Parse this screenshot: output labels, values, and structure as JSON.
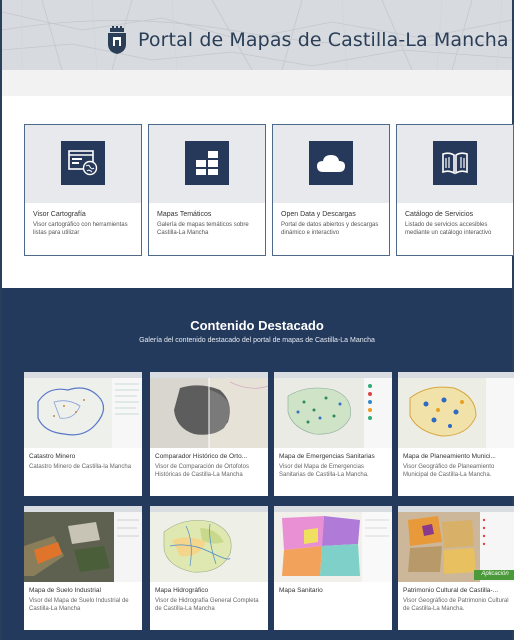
{
  "header": {
    "title": "Portal de Mapas de Castilla-La Mancha"
  },
  "cards": [
    {
      "title": "Visor Cartografía",
      "description": "Visor cartográfico con herramientas listas para utilizar",
      "icon": "web-map-icon"
    },
    {
      "title": "Mapas Temáticos",
      "description": "Galería de mapas temáticos sobre Castilla-La Mancha",
      "icon": "grid-blocks-icon"
    },
    {
      "title": "Open Data y Descargas",
      "description": "Portal de datos abiertos y descargas dinámico e interactivo",
      "icon": "cloud-icon"
    },
    {
      "title": "Catálogo de Servicios",
      "description": "Listado de servicios accesibles mediante un catálogo interactivo",
      "icon": "book-icon"
    }
  ],
  "featured": {
    "title": "Contenido Destacado",
    "subtitle": "Galería del contenido destacado del portal de mapas de Castilla-La Mancha",
    "items": [
      {
        "title": "Catastro Minero",
        "description": "Catastro Minero de Castilla-la Mancha"
      },
      {
        "title": "Comparador Histórico de Orto...",
        "description": "Visor de Comparación de Ortofotos Históricas de Castilla-La Mancha"
      },
      {
        "title": "Mapa de Emergencias Sanitarias",
        "description": "Visor del Mapa de Emergencias Sanitarias de Castilla-La Mancha."
      },
      {
        "title": "Mapa de Planeamiento Munici...",
        "description": "Visor Geográfico de Planeamiento Municipal de Castilla-La Mancha."
      },
      {
        "title": "Mapa de Suelo Industrial",
        "description": "Visor del Mapa de Suelo Industrial de Castilla-La Mancha"
      },
      {
        "title": "Mapa Hidrográfico",
        "description": "Visor de Hidrografía General Completa de Castilla-La Mancha"
      },
      {
        "title": "Mapa Sanitario",
        "description": ""
      },
      {
        "title": "Patrimonio Cultural de Castilla-...",
        "description": "Visor Geográfico de Patrimonio Cultural de Castilla-La Mancha."
      }
    ],
    "badge": "Aplicación"
  },
  "colors": {
    "navy": "#243a5c",
    "icon_bg": "#26395a",
    "header_bg": "#d7dadf"
  }
}
